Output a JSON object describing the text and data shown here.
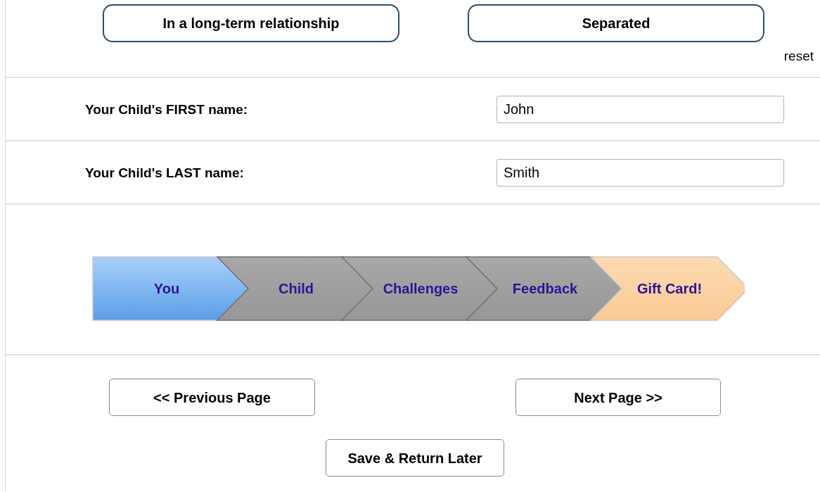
{
  "relationship_options": [
    {
      "label": "In a long-term relationship",
      "selected": false
    },
    {
      "label": "Separated",
      "selected": false
    }
  ],
  "reset_link": "reset",
  "fields": [
    {
      "label": "Your Child's FIRST name:",
      "value": "John"
    },
    {
      "label": "Your Child's LAST name:",
      "value": "Smith"
    }
  ],
  "progress_steps": [
    {
      "label": "You",
      "kind": "current"
    },
    {
      "label": "Child",
      "kind": "pending"
    },
    {
      "label": "Challenges",
      "kind": "pending"
    },
    {
      "label": "Feedback",
      "kind": "pending"
    },
    {
      "label": "Gift Card!",
      "kind": "reward"
    }
  ],
  "nav_buttons": [
    "<< Previous Page",
    "Next Page >>"
  ],
  "save_button": "Save & Return Later"
}
